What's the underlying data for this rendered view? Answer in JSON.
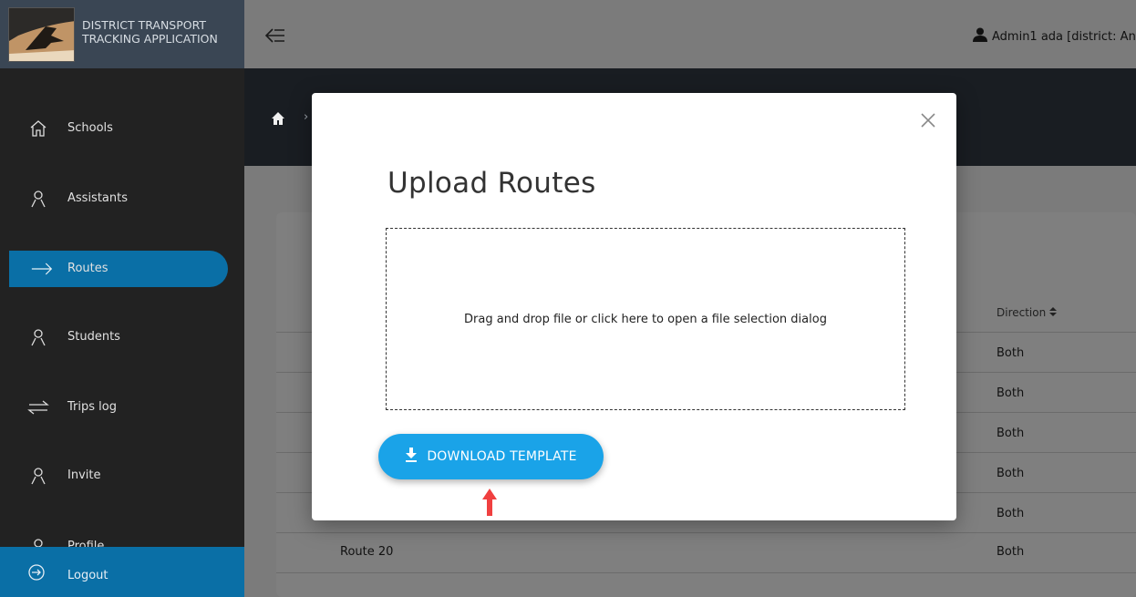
{
  "app": {
    "title": "DISTRICT TRANSPORT TRACKING APPLICATION",
    "brand_color": "#0a6fa6"
  },
  "header": {
    "user_label": "Admin1 ada [district: An"
  },
  "sidebar": {
    "items": [
      {
        "label": "Schools",
        "icon": "home-outline-icon"
      },
      {
        "label": "Assistants",
        "icon": "user-icon"
      },
      {
        "label": "Routes",
        "icon": "arrow-right-icon",
        "active": true
      },
      {
        "label": "Students",
        "icon": "user-icon"
      },
      {
        "label": "Trips log",
        "icon": "swap-arrows-icon"
      },
      {
        "label": "Invite",
        "icon": "user-icon"
      },
      {
        "label": "Profile",
        "icon": "user-icon"
      }
    ],
    "logout_label": "Logout"
  },
  "table": {
    "direction_header": "Direction",
    "rows": [
      {
        "route": "",
        "direction": "Both"
      },
      {
        "route": "",
        "direction": "Both"
      },
      {
        "route": "",
        "direction": "Both"
      },
      {
        "route": "",
        "direction": "Both"
      },
      {
        "route": "",
        "direction": "Both"
      },
      {
        "route": "Route 20",
        "direction": "Both"
      }
    ]
  },
  "modal": {
    "title": "Upload Routes",
    "dropzone_text": "Drag and drop file or click here to open a file selection dialog",
    "download_label": "DOWNLOAD TEMPLATE",
    "button_color": "#1aa3e8"
  }
}
